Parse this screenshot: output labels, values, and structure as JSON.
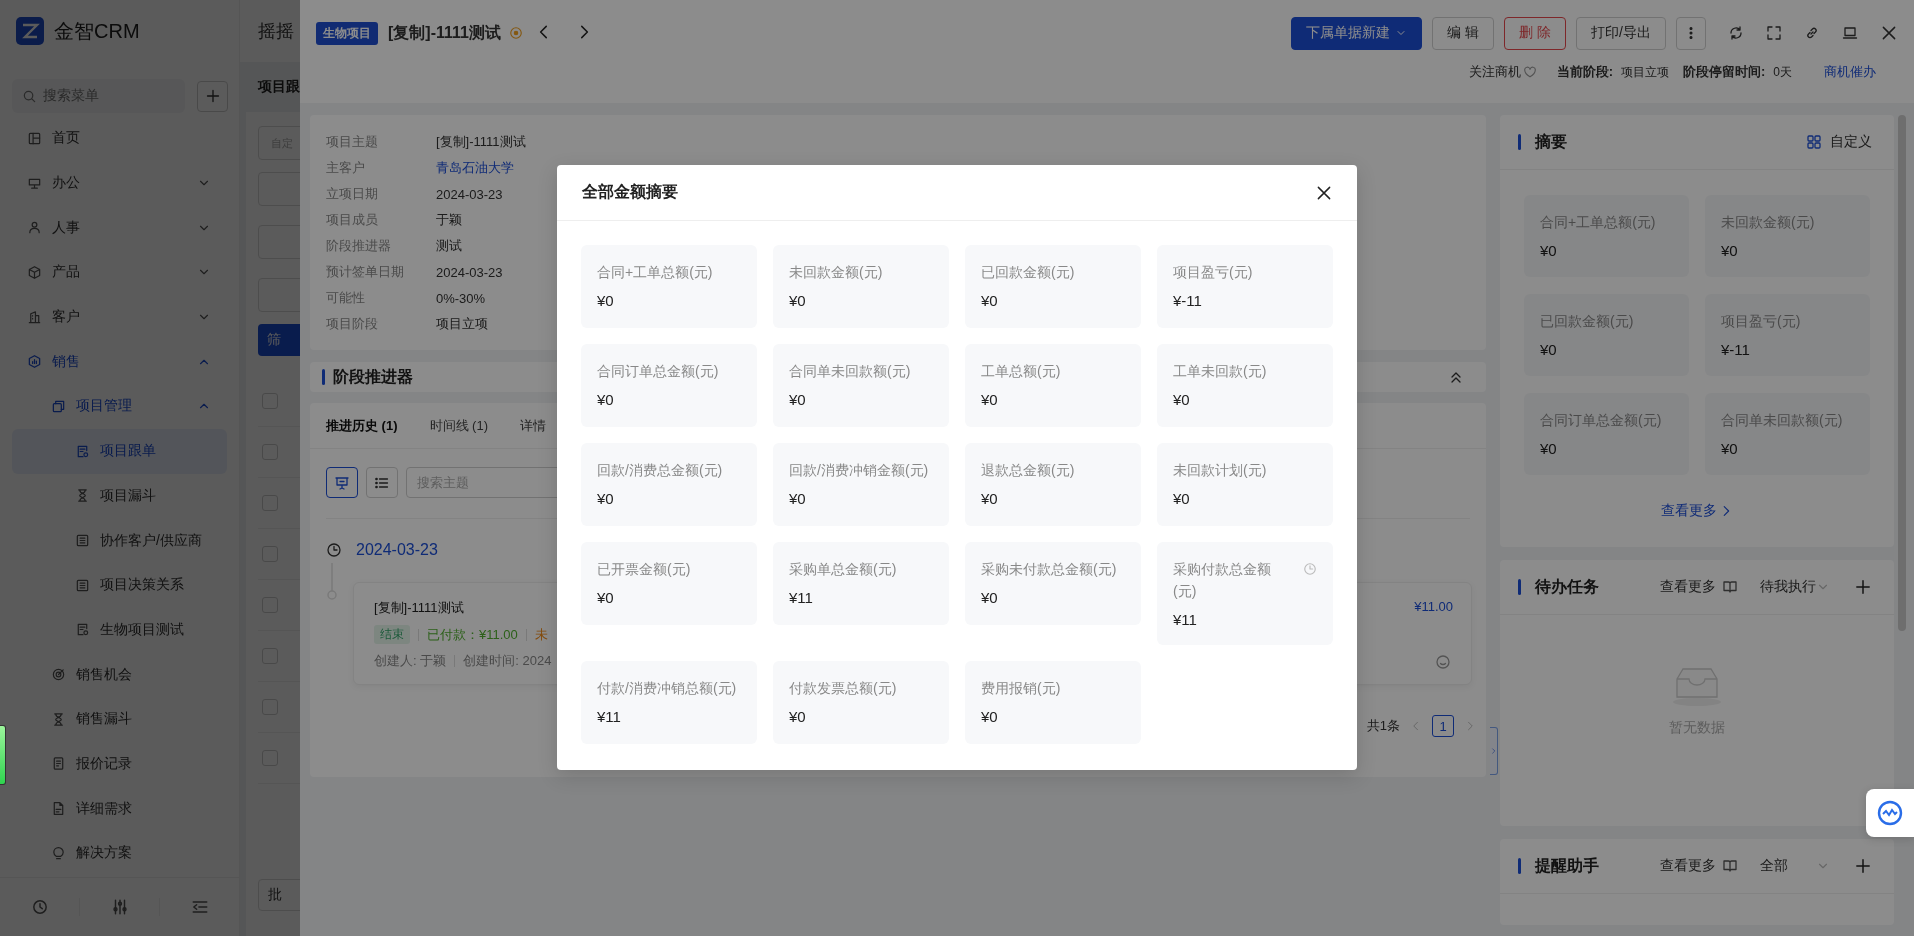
{
  "sidebar": {
    "logo": "金智CRM",
    "search_placeholder": "搜索菜单",
    "items": [
      {
        "label": "首页",
        "selected": false
      },
      {
        "label": "办公",
        "selected": false,
        "expanded": false
      },
      {
        "label": "人事",
        "selected": false,
        "expanded": false
      },
      {
        "label": "产品",
        "selected": false,
        "expanded": false
      },
      {
        "label": "客户",
        "selected": false,
        "expanded": false
      },
      {
        "label": "销售",
        "expanded": true,
        "children": [
          {
            "label": "项目管理",
            "expanded": true,
            "children": [
              {
                "label": "项目跟单",
                "selected": true
              },
              {
                "label": "项目漏斗",
                "selected": false
              },
              {
                "label": "协作客户/供应商",
                "selected": false
              },
              {
                "label": "项目决策关系",
                "selected": false
              },
              {
                "label": "生物项目测试",
                "selected": false
              }
            ]
          },
          {
            "label": "销售机会",
            "selected": false
          },
          {
            "label": "销售漏斗",
            "selected": false
          },
          {
            "label": "报价记录",
            "selected": false
          },
          {
            "label": "详细需求",
            "selected": false
          },
          {
            "label": "解决方案",
            "selected": false
          }
        ]
      }
    ]
  },
  "list_page": {
    "title": "摇摇",
    "tab": "项目跟",
    "filter_placeholder": "自定",
    "filter_button": "筛",
    "batch_button": "批",
    "rows": [
      {
        "checked": false
      },
      {
        "checked": false
      },
      {
        "checked": false
      },
      {
        "checked": false
      },
      {
        "checked": false
      },
      {
        "checked": false
      },
      {
        "checked": false
      },
      {
        "checked": false
      }
    ]
  },
  "drawer": {
    "tag": "生物项目",
    "title": "[复制]-1111测试",
    "actions": [
      {
        "label": "下属单据新建",
        "kind": "primary"
      },
      {
        "label": "编 辑",
        "kind": "default"
      },
      {
        "label": "删 除",
        "kind": "danger"
      },
      {
        "label": "打印/导出",
        "kind": "default"
      }
    ],
    "status": {
      "follow": "关注商机",
      "stage_label": "当前阶段:",
      "stage": "项目立项",
      "stay_label": "阶段停留时间:",
      "stay": "0天",
      "urge": "商机催办"
    },
    "info": [
      {
        "label": "项目主题",
        "value": "[复制]-1111测试",
        "kind": "text"
      },
      {
        "label": "主客户",
        "value": "青岛石油大学",
        "kind": "link"
      },
      {
        "label": "立项日期",
        "value": "2024-03-23",
        "kind": "text"
      },
      {
        "label": "项目成员",
        "value": "于颖",
        "kind": "text"
      },
      {
        "label": "阶段推进器",
        "value": "测试",
        "kind": "text"
      },
      {
        "label": "预计签单日期",
        "value": "2024-03-23",
        "kind": "text"
      },
      {
        "label": "可能性",
        "value": "0%-30%",
        "kind": "text"
      },
      {
        "label": "项目阶段",
        "value": "项目立项",
        "kind": "text"
      }
    ],
    "stage": {
      "title": "阶段推进器",
      "expanded": true,
      "tabs": [
        {
          "label": "推进历史 (1)",
          "selected": true
        },
        {
          "label": "时间线 (1)",
          "selected": false
        },
        {
          "label": "详情",
          "selected": false
        }
      ],
      "views": [
        {
          "kind": "board",
          "selected": true
        },
        {
          "kind": "list",
          "selected": false
        }
      ],
      "search_placeholder": "搜索主题",
      "date": "2024-03-23",
      "entry": {
        "title": "[复制]-1111测试",
        "status": "结束",
        "paid": "已付款：¥11.00",
        "unpaid": "未",
        "creator": "创建人: 于颖",
        "created": "创建时间: 2024",
        "amount": "¥11.00"
      },
      "pagination": {
        "total": "共1条",
        "pages": [
          {
            "label": "1",
            "selected": true
          }
        ]
      }
    },
    "summary": {
      "title": "摘要",
      "customize": "自定义",
      "more": "查看更多",
      "items": [
        {
          "label": "合同+工单总额(元)",
          "value": "¥0"
        },
        {
          "label": "未回款金额(元)",
          "value": "¥0"
        },
        {
          "label": "已回款金额(元)",
          "value": "¥0"
        },
        {
          "label": "项目盈亏(元)",
          "value": "¥-11"
        },
        {
          "label": "合同订单总金额(元)",
          "value": "¥0"
        },
        {
          "label": "合同单未回款额(元)",
          "value": "¥0"
        }
      ]
    },
    "todo": {
      "title": "待办任务",
      "more": "查看更多",
      "filter": "待我执行",
      "empty": "暂无数据"
    },
    "reminder": {
      "title": "提醒助手",
      "more": "查看更多",
      "filter": "全部"
    }
  },
  "modal": {
    "title": "全部金额摘要",
    "items": [
      {
        "label": "合同+工单总额(元)",
        "value": "¥0",
        "clock": false
      },
      {
        "label": "未回款金额(元)",
        "value": "¥0",
        "clock": false
      },
      {
        "label": "已回款金额(元)",
        "value": "¥0",
        "clock": false
      },
      {
        "label": "项目盈亏(元)",
        "value": "¥-11",
        "clock": false
      },
      {
        "label": "合同订单总金额(元)",
        "value": "¥0",
        "clock": false
      },
      {
        "label": "合同单未回款额(元)",
        "value": "¥0",
        "clock": false
      },
      {
        "label": "工单总额(元)",
        "value": "¥0",
        "clock": false
      },
      {
        "label": "工单未回款(元)",
        "value": "¥0",
        "clock": false
      },
      {
        "label": "回款/消费总金额(元)",
        "value": "¥0",
        "clock": false
      },
      {
        "label": "回款/消费冲销金额(元)",
        "value": "¥0",
        "clock": false
      },
      {
        "label": "退款总金额(元)",
        "value": "¥0",
        "clock": false
      },
      {
        "label": "未回款计划(元)",
        "value": "¥0",
        "clock": false
      },
      {
        "label": "已开票金额(元)",
        "value": "¥0",
        "clock": false
      },
      {
        "label": "采购单总金额(元)",
        "value": "¥11",
        "clock": false
      },
      {
        "label": "采购未付款总金额(元)",
        "value": "¥0",
        "clock": false
      },
      {
        "label": "采购付款总金额(元)",
        "value": "¥11",
        "clock": true
      },
      {
        "label": "付款/消费冲销总额(元)",
        "value": "¥11",
        "clock": false
      },
      {
        "label": "付款发票总额(元)",
        "value": "¥0",
        "clock": false
      },
      {
        "label": "费用报销(元)",
        "value": "¥0",
        "clock": false
      }
    ]
  }
}
